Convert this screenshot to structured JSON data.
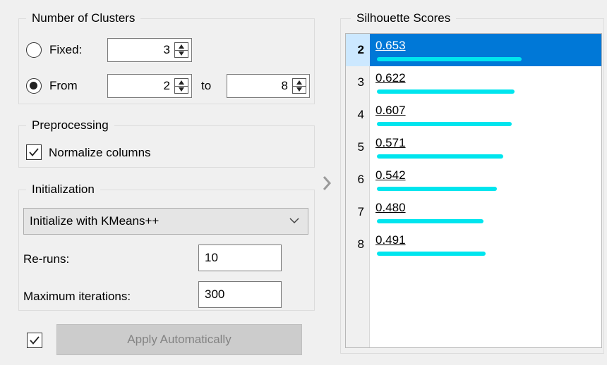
{
  "clusters": {
    "title": "Number of Clusters",
    "fixed_label": "Fixed:",
    "fixed_value": "3",
    "from_label": "From",
    "from_value": "2",
    "to_label": "to",
    "to_value": "8",
    "selected_mode": "from"
  },
  "preprocessing": {
    "title": "Preprocessing",
    "normalize_label": "Normalize columns",
    "normalize_checked": true
  },
  "initialization": {
    "title": "Initialization",
    "method": "Initialize with KMeans++",
    "reruns_label": "Re-runs:",
    "reruns_value": "10",
    "max_iter_label": "Maximum iterations:",
    "max_iter_value": "300"
  },
  "apply": {
    "checked": true,
    "label": "Apply Automatically",
    "enabled": false
  },
  "scores": {
    "title": "Silhouette Scores",
    "selected_k": 2,
    "bar_color": "#00e5ee",
    "selection_color": "#0078d7",
    "rows": [
      {
        "k": "2",
        "score": "0.653"
      },
      {
        "k": "3",
        "score": "0.622"
      },
      {
        "k": "4",
        "score": "0.607"
      },
      {
        "k": "5",
        "score": "0.571"
      },
      {
        "k": "6",
        "score": "0.542"
      },
      {
        "k": "7",
        "score": "0.480"
      },
      {
        "k": "8",
        "score": "0.491"
      }
    ]
  }
}
